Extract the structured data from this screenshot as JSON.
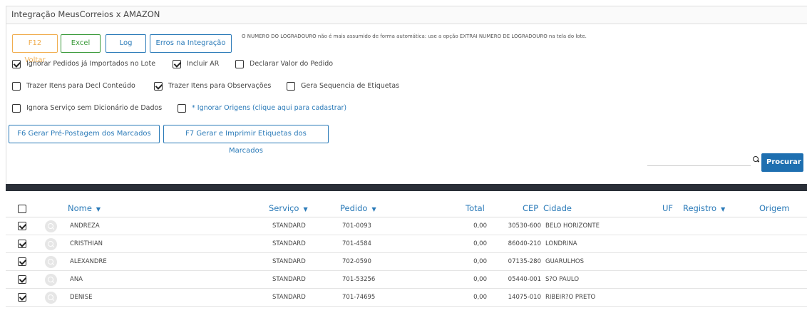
{
  "panel": {
    "title": "Integração MeusCorreios x AMAZON"
  },
  "toolbar": {
    "back_label": "F12 Voltar",
    "excel_label": "Excel",
    "log_label": "Log",
    "errors_label": "Erros na Integração",
    "notice": "O NUMERO DO LOGRADOURO não é mais assumido de forma automática: use a opção EXTRAI NUMERO DE LOGRADOURO na tela do lote."
  },
  "options": {
    "ignorar_pedidos": {
      "label": "Ignorar Pedidos já Importados no Lote",
      "checked": true
    },
    "incluir_ar": {
      "label": "Incluir AR",
      "checked": true
    },
    "declarar_valor": {
      "label": "Declarar Valor do Pedido",
      "checked": false
    },
    "trazer_decl": {
      "label": "Trazer Itens para Decl Conteúdo",
      "checked": false
    },
    "trazer_obs": {
      "label": "Trazer Itens para Observações",
      "checked": true
    },
    "gera_sequencia": {
      "label": "Gera Sequencia de Etiquetas",
      "checked": false
    },
    "ignora_servico": {
      "label": "Ignora Serviço sem Dicionário de Dados",
      "checked": false
    },
    "ignorar_origens": {
      "label": "* Ignorar Origens (clique aqui para cadastrar)",
      "checked": false
    }
  },
  "actions": {
    "pre_postagem_label": "F6 Gerar Pré-Postagem dos Marcados",
    "etiquetas_label": "F7 Gerar e Imprimir Etiquetas dos Marcados",
    "search_button_label": "Procurar",
    "search_value": ""
  },
  "table": {
    "columns": {
      "nome": "Nome",
      "servico": "Serviço",
      "pedido": "Pedido",
      "total": "Total",
      "cep": "CEP",
      "cidade": "Cidade",
      "uf": "UF",
      "registro": "Registro",
      "origem": "Origem"
    },
    "rows": [
      {
        "checked": true,
        "nome": "ANDREZA",
        "servico": "STANDARD",
        "pedido": "701-0093",
        "total": "0,00",
        "cep": "30530-600",
        "cidade": "BELO HORIZONTE"
      },
      {
        "checked": true,
        "nome": "CRISTHIAN",
        "servico": "STANDARD",
        "pedido": "701-4584",
        "total": "0,00",
        "cep": "86040-210",
        "cidade": "LONDRINA"
      },
      {
        "checked": true,
        "nome": "ALEXANDRE",
        "servico": "STANDARD",
        "pedido": "702-0590",
        "total": "0,00",
        "cep": "07135-280",
        "cidade": "GUARULHOS"
      },
      {
        "checked": true,
        "nome": "ANA",
        "servico": "STANDARD",
        "pedido": "701-53256",
        "total": "0,00",
        "cep": "05440-001",
        "cidade": "S?O PAULO"
      },
      {
        "checked": true,
        "nome": "DENISE",
        "servico": "STANDARD",
        "pedido": "701-74695",
        "total": "0,00",
        "cep": "14075-010",
        "cidade": "RIBEIR?O PRETO"
      }
    ]
  },
  "colors": {
    "accent": "#1e6fb0",
    "link": "#2a7ab8",
    "back": "#f0ad4e",
    "excel": "#3a9a3a",
    "dark_bar": "#2a2f38"
  }
}
